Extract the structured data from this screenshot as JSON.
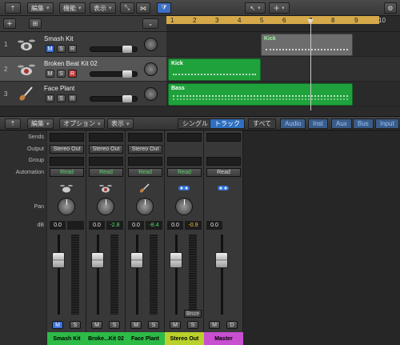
{
  "toolbar": {
    "edit": "編集",
    "functions": "機能",
    "view": "表示"
  },
  "tracks": [
    {
      "num": "1",
      "name": "Smash Kit",
      "mute": "M",
      "solo": "S",
      "rec": "R"
    },
    {
      "num": "2",
      "name": "Broken Beat Kit 02",
      "mute": "M",
      "solo": "S",
      "rec": "R"
    },
    {
      "num": "3",
      "name": "Face Plant",
      "mute": "M",
      "solo": "S",
      "rec": "R"
    }
  ],
  "ruler": [
    "1",
    "2",
    "3",
    "4",
    "5",
    "6",
    "7",
    "8",
    "9",
    "10"
  ],
  "regions": {
    "kick1": "Kick",
    "kick2": "Kick",
    "bass": "Bass"
  },
  "mixer_toolbar": {
    "edit": "編集",
    "options": "オプション",
    "view": "表示",
    "single": "シングル",
    "tracks": "トラック",
    "all": "すべて",
    "audio": "Audio",
    "inst": "Inst",
    "aux": "Aux",
    "bus": "Bus",
    "input": "Input"
  },
  "mixer_labels": {
    "sends": "Sends",
    "output": "Output",
    "group": "Group",
    "automation": "Automation",
    "pan": "Pan",
    "db": "dB"
  },
  "strips": [
    {
      "output": "Stereo Out",
      "automation": "Read",
      "db": "0.0",
      "peak": "",
      "name": "Smash Kit",
      "name_color": "#2dbb47",
      "mute": "M",
      "solo": "S"
    },
    {
      "output": "Stereo Out",
      "automation": "Read",
      "db": "0.0",
      "peak": "-2.8",
      "name": "Broke...Kit 02",
      "name_color": "#2dbb47",
      "mute": "M",
      "solo": "S"
    },
    {
      "output": "Stereo Out",
      "automation": "Read",
      "db": "0.0",
      "peak": "-8.4",
      "name": "Face Plant",
      "name_color": "#2dbb47",
      "mute": "M",
      "solo": "S"
    },
    {
      "output": "",
      "automation": "Read",
      "db": "0.0",
      "peak": "-0.9",
      "name": "Stereo Out",
      "name_color": "#b9d12a",
      "mute": "M",
      "solo": "S",
      "bnce": "Bnce"
    },
    {
      "output": "",
      "automation": "Read",
      "db": "0.0",
      "peak": "",
      "name": "Master",
      "name_color": "#c74fd0",
      "mute": "M",
      "solo": "D"
    }
  ],
  "colors": {
    "region_green": "#1fa23c",
    "ruler": "#d5a94a",
    "selected": "#2f6fbf"
  }
}
